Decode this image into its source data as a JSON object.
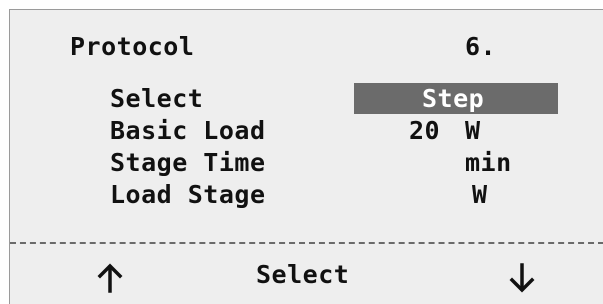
{
  "header": {
    "title": "Protocol",
    "protocol_number": "6."
  },
  "fields": [
    {
      "label": "Select",
      "value": "Step",
      "unit": ""
    },
    {
      "label": "Basic Load",
      "value": "20",
      "unit": "W"
    },
    {
      "label": "Stage Time",
      "value": "",
      "unit": "min"
    },
    {
      "label": "Load Stage",
      "value": "",
      "unit": "W"
    }
  ],
  "softkeys": {
    "left_icon": "arrow-up-icon",
    "center_label": "Select",
    "right_icon": "arrow-down-icon"
  },
  "colors": {
    "screen_background": "#eeeeee",
    "highlight_background": "#6b6b6b",
    "highlight_text": "#ffffff",
    "text": "#111111"
  }
}
